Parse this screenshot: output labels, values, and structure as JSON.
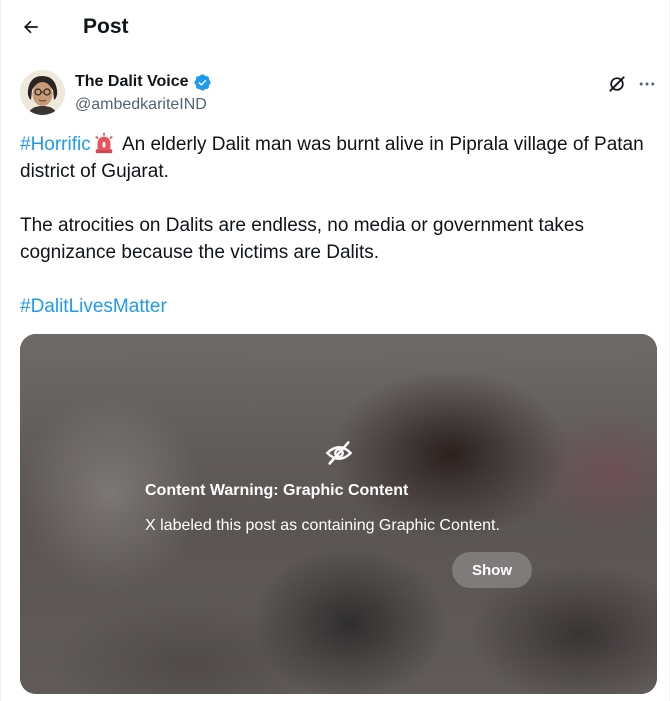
{
  "header": {
    "title": "Post",
    "back_icon": "arrow-left-icon"
  },
  "author": {
    "name": "The Dalit Voice",
    "handle": "@ambedkariteIND",
    "verified": true,
    "verified_color": "#1d9bf0",
    "avatar": "portrait-photo"
  },
  "actions": {
    "grok_icon": "grok-icon",
    "more_icon": "more-horizontal-icon"
  },
  "post": {
    "hashtag1": "#Horrific",
    "emoji": "siren-emoji",
    "line1": " An elderly Dalit man was burnt alive in Piprala village of Patan district of Gujarat.",
    "para2": "The atrocities on Dalits are endless, no media or government takes cognizance because the victims are Dalits.",
    "hashtag2": "#DalitLivesMatter",
    "link_color": "#1d9bf0"
  },
  "media_warning": {
    "icon": "eye-off-icon",
    "title": "Content Warning: Graphic Content",
    "description": "X labeled this post as containing Graphic Content.",
    "show_label": "Show"
  }
}
